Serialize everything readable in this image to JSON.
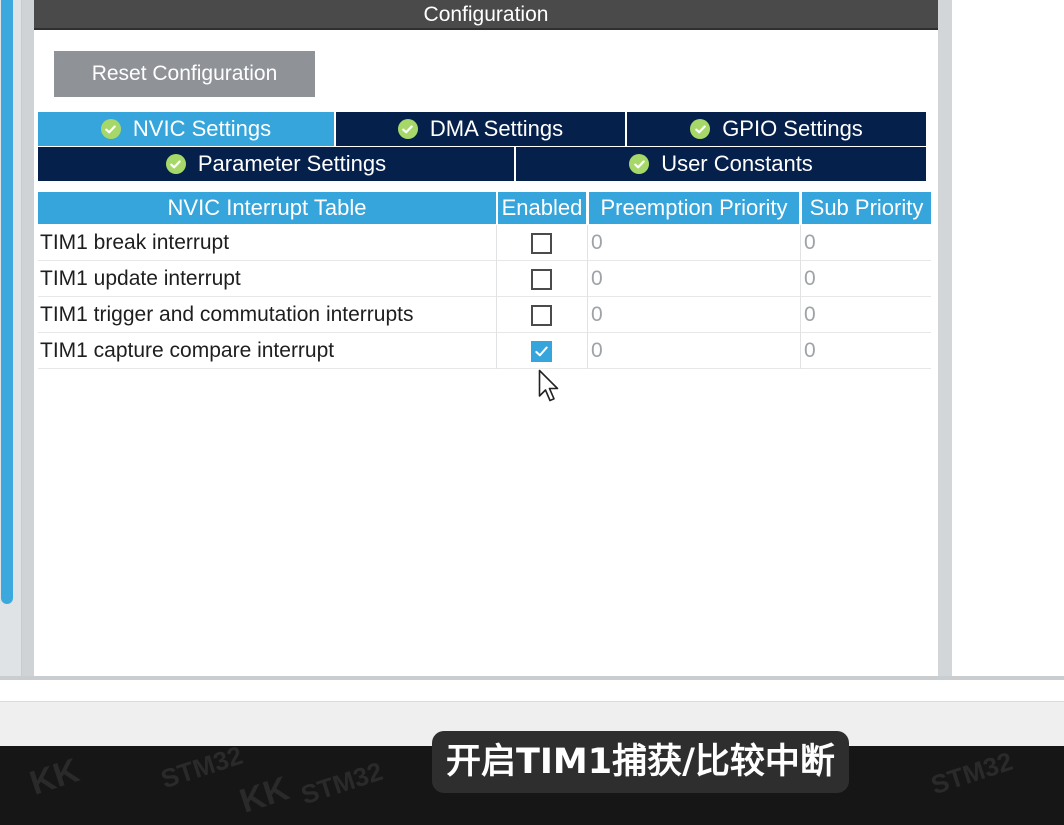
{
  "panel": {
    "title": "Configuration",
    "reset_label": "Reset Configuration"
  },
  "tabs": [
    {
      "label": "NVIC Settings",
      "active": true,
      "icon": "check-circle-icon"
    },
    {
      "label": "DMA Settings",
      "active": false,
      "icon": "check-circle-icon"
    },
    {
      "label": "GPIO Settings",
      "active": false,
      "icon": "check-circle-icon"
    },
    {
      "label": "Parameter Settings",
      "active": false,
      "icon": "check-circle-icon"
    },
    {
      "label": "User Constants",
      "active": false,
      "icon": "check-circle-icon"
    }
  ],
  "table": {
    "headers": [
      "NVIC Interrupt Table",
      "Enabled",
      "Preemption Priority",
      "Sub Priority"
    ],
    "rows": [
      {
        "name": "TIM1 break interrupt",
        "enabled": false,
        "preemption": "0",
        "sub": "0"
      },
      {
        "name": "TIM1 update interrupt",
        "enabled": false,
        "preemption": "0",
        "sub": "0"
      },
      {
        "name": "TIM1 trigger and commutation interrupts",
        "enabled": false,
        "preemption": "0",
        "sub": "0"
      },
      {
        "name": "TIM1 capture compare interrupt",
        "enabled": true,
        "preemption": "0",
        "sub": "0"
      }
    ]
  },
  "subtitle": "开启TIM1捕获/比较中断",
  "colors": {
    "header_bg": "#4a4a4a",
    "tab_active": "#36a5dc",
    "tab_dark": "#05204a",
    "check_icon": "#a6d869",
    "reset_button": "#8f9297"
  }
}
